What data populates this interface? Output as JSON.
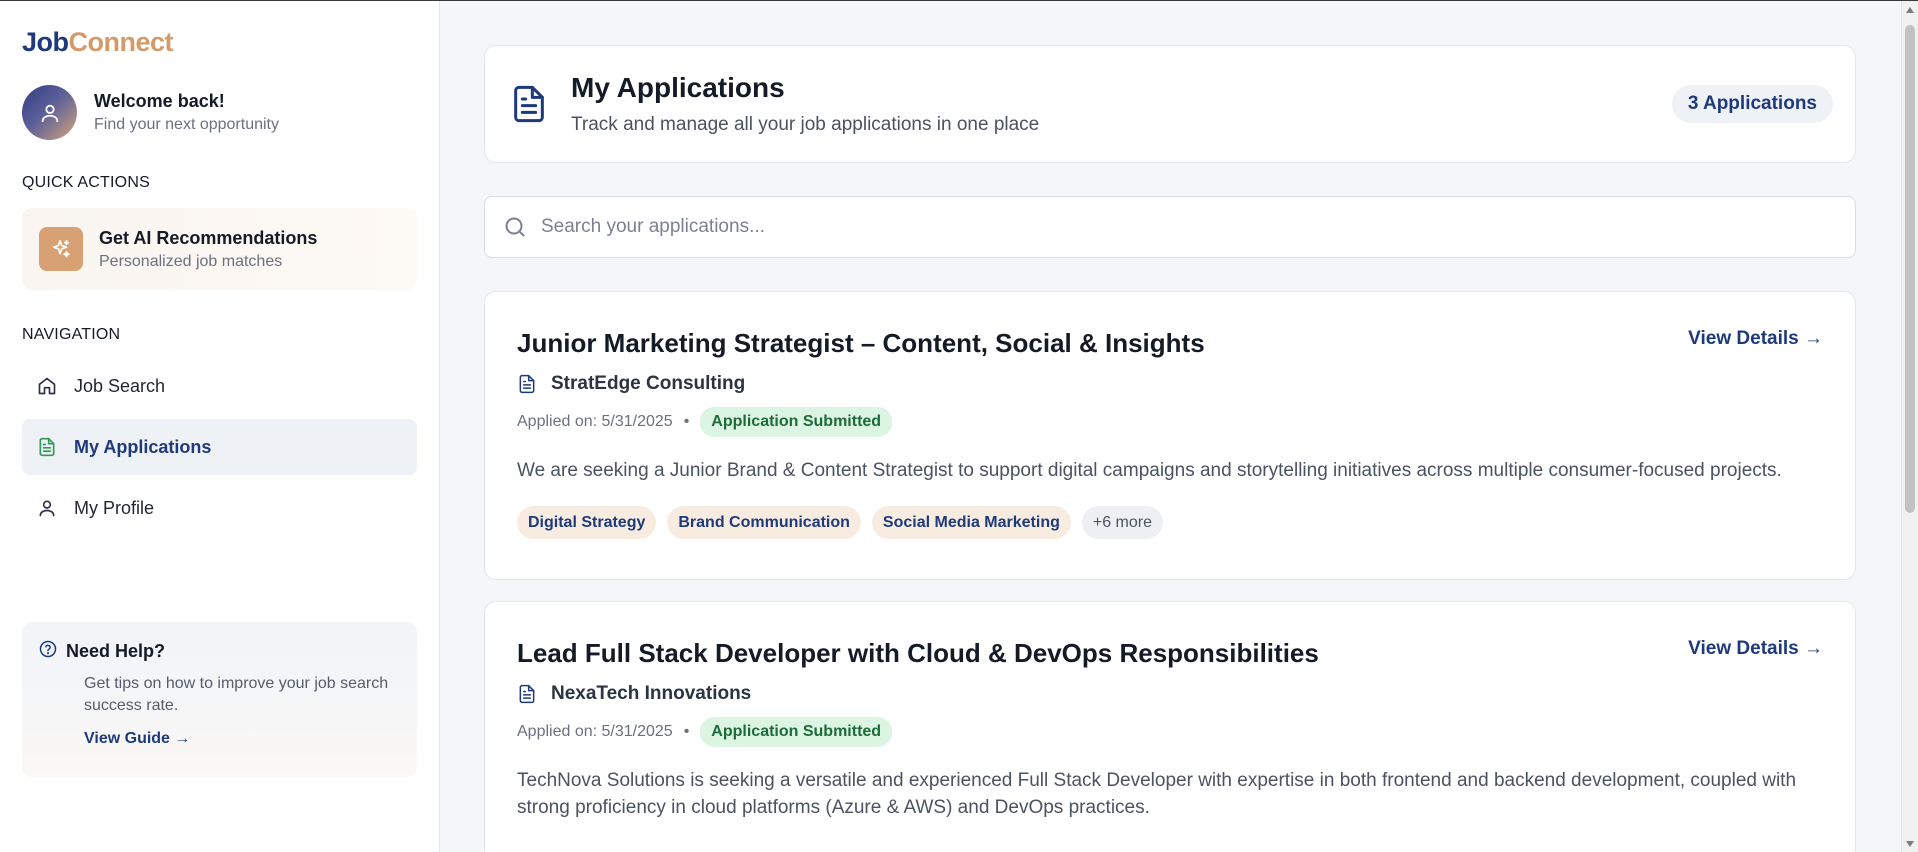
{
  "app": {
    "logo_part1": "Job",
    "logo_part2": "Connect"
  },
  "sidebar": {
    "welcome_title": "Welcome back!",
    "welcome_sub": "Find your next opportunity",
    "quick_actions_label": "QUICK ACTIONS",
    "ai_card": {
      "title": "Get AI Recommendations",
      "subtitle": "Personalized job matches",
      "icon": "sparkles-icon"
    },
    "navigation_label": "NAVIGATION",
    "nav_items": [
      {
        "label": "Job Search",
        "icon": "home-icon"
      },
      {
        "label": "My Applications",
        "icon": "document-icon",
        "active": true
      },
      {
        "label": "My Profile",
        "icon": "user-icon"
      }
    ],
    "help": {
      "title": "Need Help?",
      "description": "Get tips on how to improve your job search success rate.",
      "link": "View Guide →"
    }
  },
  "header": {
    "title": "My Applications",
    "subtitle": "Track and manage all your job applications in one place",
    "count_badge": "3 Applications"
  },
  "search": {
    "placeholder": "Search your applications...",
    "value": ""
  },
  "applications": [
    {
      "title": "Junior Marketing Strategist – Content, Social & Insights",
      "company": "StratEdge Consulting",
      "applied": "Applied on: 5/31/2025",
      "separator": "•",
      "status": "Application Submitted",
      "description": "We are seeking a Junior Brand & Content Strategist to support digital campaigns and storytelling initiatives across multiple consumer-focused projects.",
      "tags": [
        "Digital Strategy",
        "Brand Communication",
        "Social Media Marketing"
      ],
      "more_tags": "+6 more",
      "view_details": "View Details →"
    },
    {
      "title": "Lead Full Stack Developer with Cloud & DevOps Responsibilities",
      "company": "NexaTech Innovations",
      "applied": "Applied on: 5/31/2025",
      "separator": "•",
      "status": "Application Submitted",
      "description": "TechNova Solutions is seeking a versatile and experienced Full Stack Developer with expertise in both frontend and backend development, coupled with strong proficiency in cloud platforms (Azure & AWS) and DevOps practices.",
      "view_details": "View Details →"
    }
  ],
  "colors": {
    "brand_navy": "#1e3a7b",
    "brand_tan": "#d39b6a",
    "status_green_bg": "#dcf5e3",
    "status_green_text": "#1d6b3a",
    "tag_bg": "#f8ece0"
  }
}
